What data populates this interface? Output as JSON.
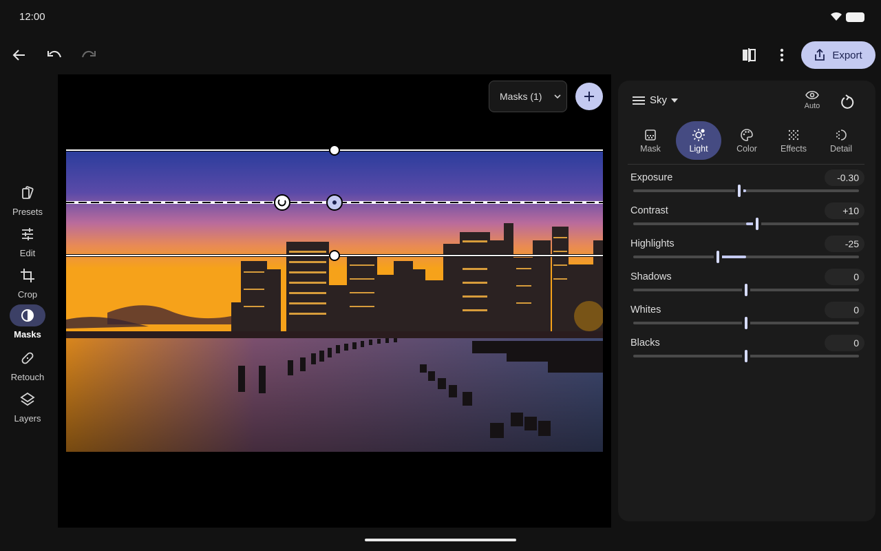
{
  "status": {
    "time": "12:00"
  },
  "toolbar": {
    "export_label": "Export"
  },
  "rail": {
    "items": [
      {
        "label": "Presets",
        "icon": "presets-icon"
      },
      {
        "label": "Edit",
        "icon": "sliders-icon"
      },
      {
        "label": "Crop",
        "icon": "crop-icon"
      },
      {
        "label": "Masks",
        "icon": "mask-icon",
        "active": true
      },
      {
        "label": "Retouch",
        "icon": "bandage-icon"
      },
      {
        "label": "Layers",
        "icon": "layers-icon"
      }
    ]
  },
  "canvas": {
    "masks_label": "Masks (1)"
  },
  "panel": {
    "mask_name": "Sky",
    "auto_label": "Auto",
    "tabs": [
      {
        "label": "Mask",
        "icon": "mask-grid-icon"
      },
      {
        "label": "Light",
        "icon": "sun-icon",
        "active": true
      },
      {
        "label": "Color",
        "icon": "palette-icon"
      },
      {
        "label": "Effects",
        "icon": "effects-icon"
      },
      {
        "label": "Detail",
        "icon": "detail-icon"
      }
    ],
    "sliders": [
      {
        "name": "Exposure",
        "value": "-0.30",
        "level": -0.3,
        "range": [
          -5,
          5
        ]
      },
      {
        "name": "Contrast",
        "value": "+10",
        "level": 10,
        "range": [
          -100,
          100
        ]
      },
      {
        "name": "Highlights",
        "value": "-25",
        "level": -25,
        "range": [
          -100,
          100
        ]
      },
      {
        "name": "Shadows",
        "value": "0",
        "level": 0,
        "range": [
          -100,
          100
        ]
      },
      {
        "name": "Whites",
        "value": "0",
        "level": 0,
        "range": [
          -100,
          100
        ]
      },
      {
        "name": "Blacks",
        "value": "0",
        "level": 0,
        "range": [
          -100,
          100
        ]
      }
    ]
  },
  "colors": {
    "accent": "#c4caf1",
    "accent_dark": "#454b82"
  }
}
